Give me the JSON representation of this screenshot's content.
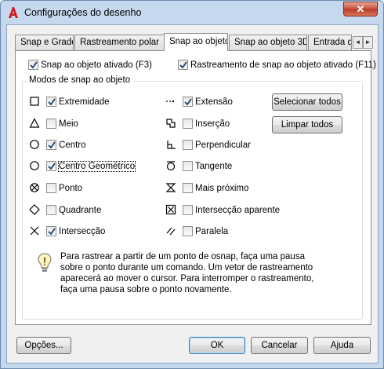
{
  "window": {
    "title": "Configurações do desenho",
    "close_label": "✕"
  },
  "tabs": [
    "Snap e Grade",
    "Rastreamento polar",
    "Snap ao objeto",
    "Snap ao objeto 3D",
    "Entrada din"
  ],
  "active_tab": "Snap ao objeto",
  "tab_scroll": {
    "left": "◄",
    "right": "►"
  },
  "top_options": {
    "snap_on": {
      "label": "Snap ao objeto ativado (F3)",
      "checked": true
    },
    "tracking_on": {
      "label": "Rastreamento de snap ao objeto ativado (F11)",
      "checked": true
    }
  },
  "group": {
    "label": "Modos de snap ao objeto",
    "left_modes": [
      {
        "icon": "endpoint-icon",
        "label": "Extremidade",
        "checked": true
      },
      {
        "icon": "midpoint-icon",
        "label": "Meio",
        "checked": false
      },
      {
        "icon": "center-icon",
        "label": "Centro",
        "checked": true
      },
      {
        "icon": "geometric-center-icon",
        "label": "Centro Geométrico",
        "checked": true
      },
      {
        "icon": "node-icon",
        "label": "Ponto",
        "checked": false
      },
      {
        "icon": "quadrant-icon",
        "label": "Quadrante",
        "checked": false
      },
      {
        "icon": "intersection-icon",
        "label": "Intersecção",
        "checked": true
      }
    ],
    "right_modes": [
      {
        "icon": "extension-icon",
        "label": "Extensão",
        "checked": true
      },
      {
        "icon": "insertion-icon",
        "label": "Inserção",
        "checked": false
      },
      {
        "icon": "perpendicular-icon",
        "label": "Perpendicular",
        "checked": false
      },
      {
        "icon": "tangent-icon",
        "label": "Tangente",
        "checked": false
      },
      {
        "icon": "nearest-icon",
        "label": "Mais próximo",
        "checked": false
      },
      {
        "icon": "apparent-intersection-icon",
        "label": "Intersecção aparente",
        "checked": false
      },
      {
        "icon": "parallel-icon",
        "label": "Paralela",
        "checked": false
      }
    ],
    "select_all": "Selecionar todos",
    "clear_all": "Limpar todos",
    "info_text": "Para rastrear a partir de um ponto de osnap, faça uma pausa sobre o ponto durante um comando. Um vetor de rastreamento aparecerá ao mover o cursor. Para interromper o rastreamento, faça uma pausa sobre o ponto novamente."
  },
  "footer": {
    "options": "Opções...",
    "ok": "OK",
    "cancel": "Cancelar",
    "help": "Ajuda"
  }
}
